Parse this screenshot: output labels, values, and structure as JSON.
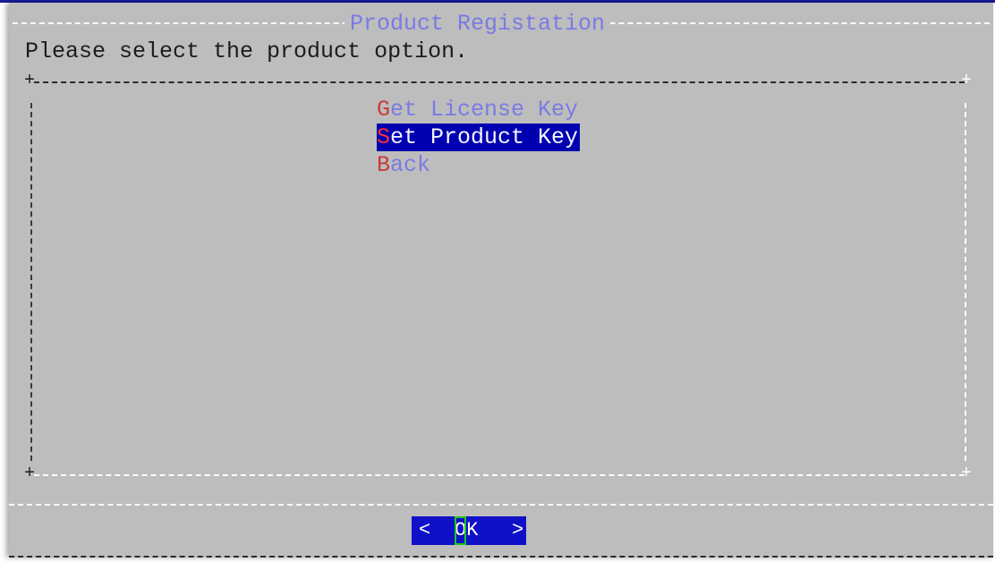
{
  "dialog": {
    "title": "Product Registation",
    "prompt": "Please select the product option."
  },
  "menu": {
    "selected_index": 1,
    "items": [
      {
        "hotkey": "G",
        "rest": "et License Key",
        "selected": false
      },
      {
        "hotkey": "S",
        "rest": "et Product Key",
        "selected": true
      },
      {
        "hotkey": "B",
        "rest": "ack",
        "selected": false
      }
    ]
  },
  "buttons": {
    "ok": {
      "left": "<",
      "hotkey": "O",
      "rest": "K",
      "right": ">"
    }
  },
  "colors": {
    "dialog_bg": "#bdbdbd",
    "title_text": "#7a7ae6",
    "hotkey": "#cc3b3b",
    "selection_bg": "#0000b0",
    "button_bg": "#1010c8",
    "focus_cursor": "#19c919"
  }
}
